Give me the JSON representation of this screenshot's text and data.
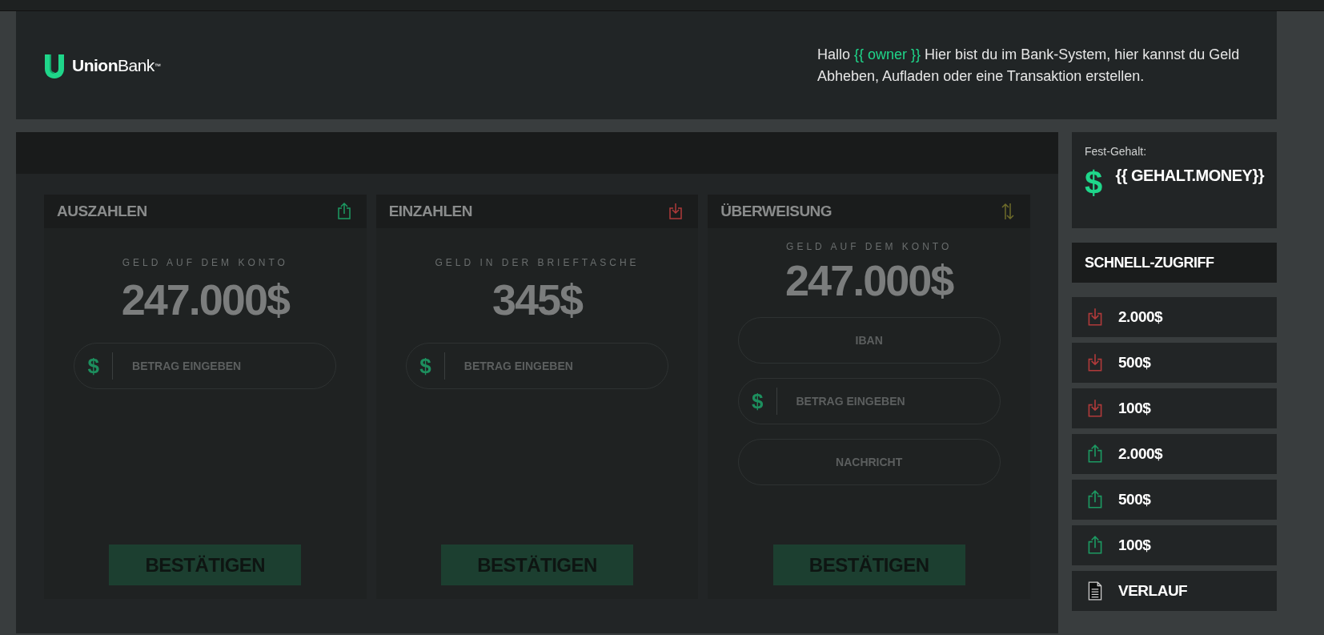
{
  "header": {
    "logo": {
      "brand_bold": "Union",
      "brand_light": "Bank",
      "trademark": "™"
    },
    "greeting": [
      {
        "text": "Hallo ",
        "highlight": false
      },
      {
        "text": "{{ owner }}",
        "highlight": true
      },
      {
        "text": " Hier bist du im Bank-System, hier kannst du Geld Abheben, Aufladen oder eine Transaktion erstellen.",
        "highlight": false
      }
    ]
  },
  "cards": [
    {
      "title": "AUSZAHLEN",
      "kind": "upload",
      "caption": "GELD AUF DEM KONTO",
      "amount": "247.000$",
      "fields": [
        {
          "kind": "amount",
          "prefix": "$",
          "placeholder": "BETRAG EINGEBEN"
        }
      ],
      "button": "BESTÄTIGEN"
    },
    {
      "title": "EINZAHLEN",
      "kind": "download",
      "caption": "GELD IN DER BRIEFTASCHE",
      "amount": "345$",
      "fields": [
        {
          "kind": "amount",
          "prefix": "$",
          "placeholder": "BETRAG EINGEBEN"
        }
      ],
      "button": "BESTÄTIGEN"
    },
    {
      "title": "ÜBERWEISUNG",
      "kind": "swap",
      "caption": "GELD AUF DEM KONTO",
      "amount": "247.000$",
      "fields": [
        {
          "kind": "text",
          "placeholder": "IBAN"
        },
        {
          "kind": "amount",
          "prefix": "$",
          "placeholder": "BETRAG EINGEBEN"
        },
        {
          "kind": "text",
          "placeholder": "NACHRICHT"
        }
      ],
      "button": "BESTÄTIGEN"
    }
  ],
  "sidebar": {
    "salary": {
      "label": "Fest-Gehalt:",
      "currency": "$",
      "value": "{{ GEHALT.MONEY}}"
    },
    "quick_access_title": "SCHNELL-ZUGRIFF",
    "items": [
      {
        "kind": "download",
        "label": "2.000$"
      },
      {
        "kind": "download",
        "label": "500$"
      },
      {
        "kind": "download",
        "label": "100$"
      },
      {
        "kind": "upload",
        "label": "2.000$"
      },
      {
        "kind": "upload",
        "label": "500$"
      },
      {
        "kind": "upload",
        "label": "100$"
      },
      {
        "kind": "document",
        "label": "VERLAUF"
      }
    ]
  }
}
